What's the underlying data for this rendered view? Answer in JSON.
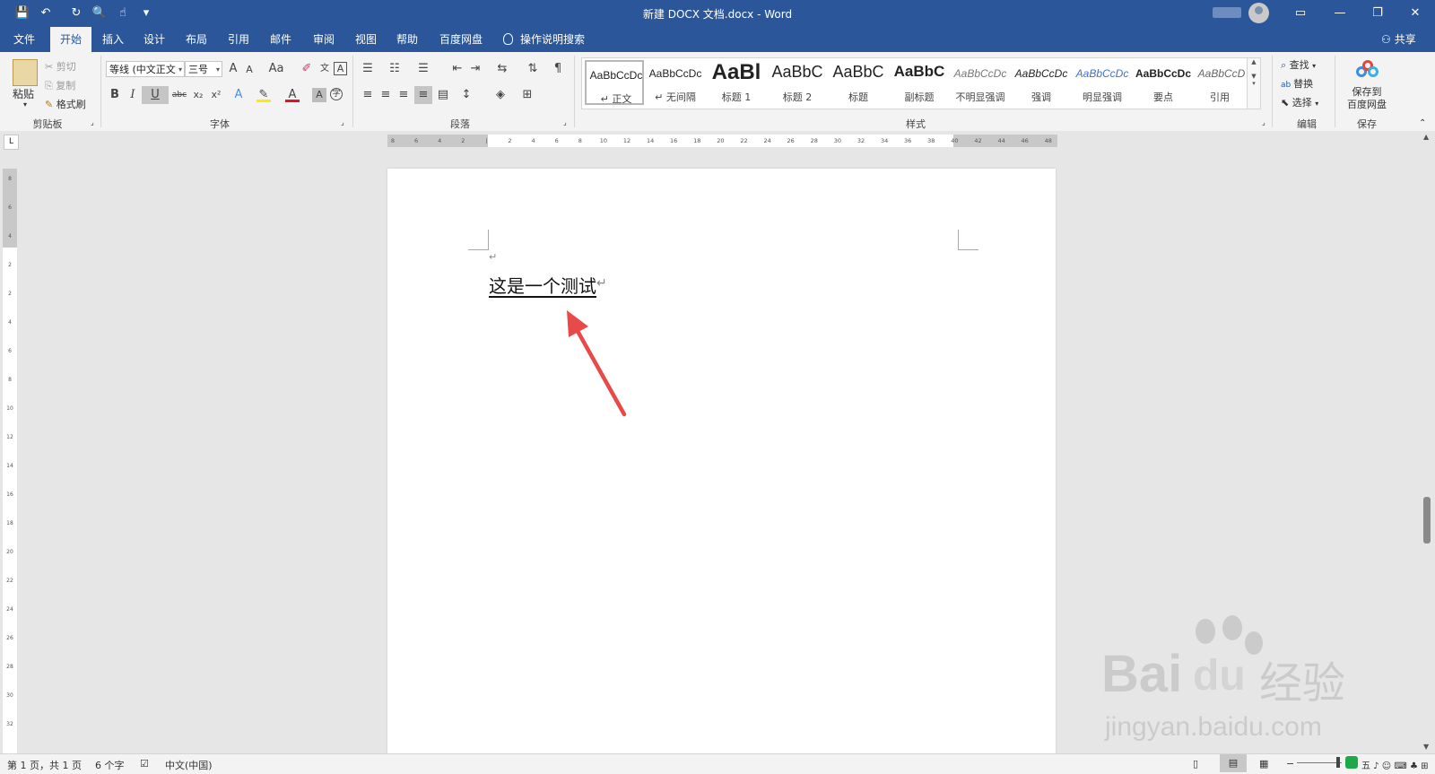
{
  "window": {
    "title": "新建 DOCX 文档.docx  -  Word",
    "controls": {
      "ribbon_display": "▭",
      "minimize": "—",
      "restore": "❐",
      "close": "✕"
    }
  },
  "quick_access": {
    "save": "💾",
    "undo": "↶",
    "redo": "↻",
    "print_preview": "🔍",
    "touch_mode": "☝",
    "customize": "▾"
  },
  "tabs": [
    "文件",
    "开始",
    "插入",
    "设计",
    "布局",
    "引用",
    "邮件",
    "审阅",
    "视图",
    "帮助",
    "百度网盘"
  ],
  "active_tab": "开始",
  "tell_me": "操作说明搜索",
  "share": "共享",
  "ribbon": {
    "clipboard": {
      "paste": "粘贴",
      "cut": "剪切",
      "copy": "复制",
      "format_painter": "格式刷",
      "label": "剪贴板"
    },
    "font": {
      "font_name": "等线 (中文正文",
      "font_size": "三号",
      "grow": "A",
      "shrink": "A",
      "change_case": "Aa",
      "bold": "B",
      "italic": "I",
      "underline": "U",
      "strike": "abc",
      "subscript": "x₂",
      "superscript": "x²",
      "label": "字体"
    },
    "paragraph": {
      "label": "段落"
    },
    "styles": {
      "items": [
        {
          "sample": "AaBbCcDc",
          "name": "↵ 正文"
        },
        {
          "sample": "AaBbCcDc",
          "name": "↵ 无间隔"
        },
        {
          "sample": "AaBl",
          "name": "标题 1"
        },
        {
          "sample": "AaBbC",
          "name": "标题 2"
        },
        {
          "sample": "AaBbC",
          "name": "标题"
        },
        {
          "sample": "AaBbC",
          "name": "副标题"
        },
        {
          "sample": "AaBbCcDc",
          "name": "不明显强调"
        },
        {
          "sample": "AaBbCcDc",
          "name": "强调"
        },
        {
          "sample": "AaBbCcDc",
          "name": "明显强调"
        },
        {
          "sample": "AaBbCcDc",
          "name": "要点"
        },
        {
          "sample": "AaBbCcDc",
          "name": "引用"
        }
      ],
      "label": "样式"
    },
    "editing": {
      "find": "查找",
      "replace": "替换",
      "select": "选择",
      "label": "编辑"
    },
    "save": {
      "button": "保存到\n百度网盘",
      "line1": "保存到",
      "line2": "百度网盘",
      "label": "保存"
    }
  },
  "ruler": {
    "ticks": [
      "8",
      "6",
      "4",
      "2",
      "",
      "2",
      "4",
      "6",
      "8",
      "10",
      "12",
      "14",
      "16",
      "18",
      "20",
      "22",
      "24",
      "26",
      "28",
      "30",
      "32",
      "34",
      "36",
      "38",
      "40",
      "42",
      "44",
      "46",
      "48"
    ],
    "tab_selector": "L"
  },
  "document": {
    "text": "这是一个测试",
    "paragraph_mark": "↵",
    "empty_mark": "↵"
  },
  "status": {
    "page": "第 1 页，共 1 页",
    "words": "6 个字",
    "language": "中文(中国)"
  },
  "watermark": {
    "brand": "Bai",
    "brand2": "du",
    "suffix": "经验",
    "url": "jingyan.baidu.com"
  },
  "colors": {
    "title_bar": "#2b579a",
    "annotation_arrow": "#e84a4a"
  }
}
